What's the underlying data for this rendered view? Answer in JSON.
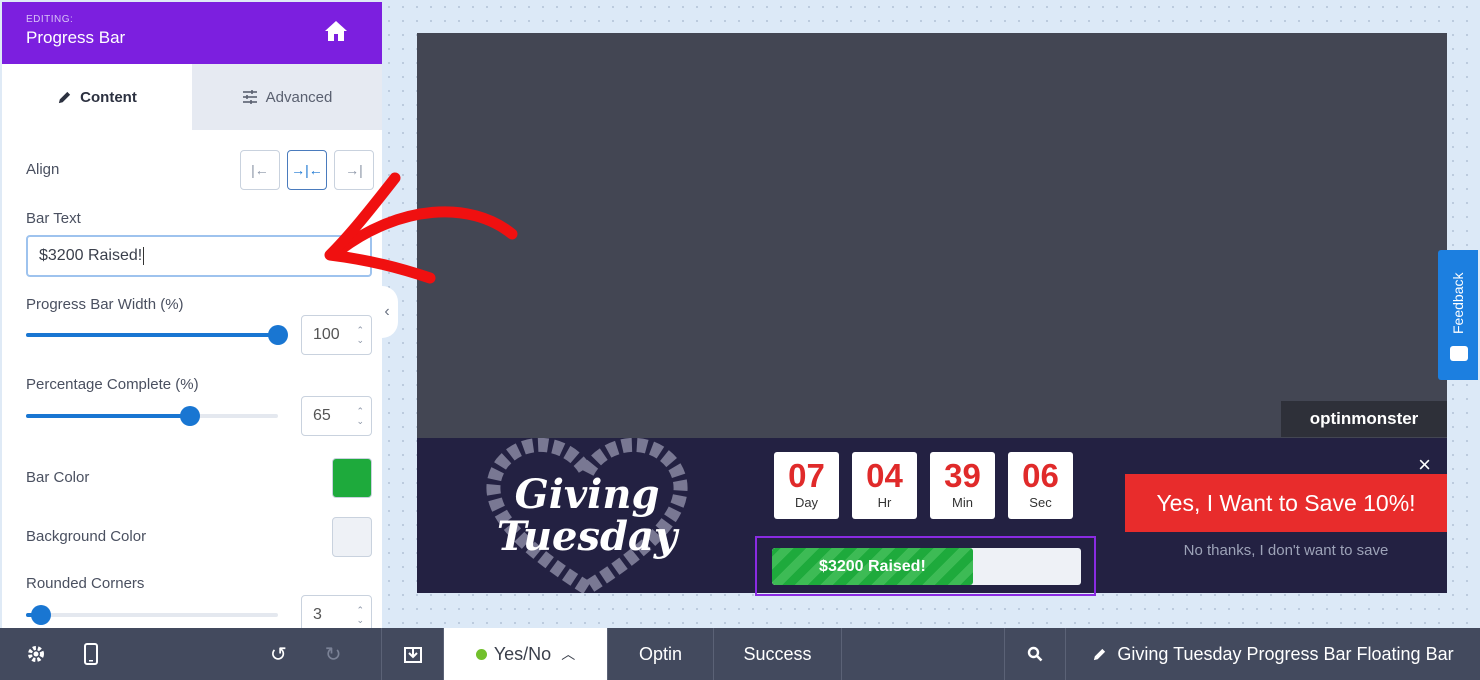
{
  "panel": {
    "eyebrow": "EDITING:",
    "title": "Progress Bar",
    "tabs": [
      {
        "label": "Content",
        "icon": "pencil-icon",
        "active": true
      },
      {
        "label": "Advanced",
        "icon": "sliders-icon",
        "active": false
      }
    ],
    "align": {
      "label": "Align",
      "options": [
        "left",
        "center",
        "right"
      ],
      "selected": "center"
    },
    "bar_text": {
      "label": "Bar Text",
      "value": "$3200 Raised!"
    },
    "bar_width": {
      "label": "Progress Bar Width (%)",
      "value": "100",
      "fraction": 1.0
    },
    "percent_complete": {
      "label": "Percentage Complete (%)",
      "value": "65",
      "fraction": 0.65
    },
    "bar_color": {
      "label": "Bar Color",
      "color": "#1eaa3c"
    },
    "bg_color": {
      "label": "Background Color",
      "color": "#eef1f6"
    },
    "rounded": {
      "label": "Rounded Corners",
      "value": "3",
      "fraction": 0.06
    }
  },
  "preview": {
    "brand": "optinmonster",
    "art_line1": "Giving",
    "art_line2": "Tuesday",
    "countdown": [
      {
        "num": "07",
        "unit": "Day"
      },
      {
        "num": "04",
        "unit": "Hr"
      },
      {
        "num": "39",
        "unit": "Min"
      },
      {
        "num": "06",
        "unit": "Sec"
      }
    ],
    "bar_text": "$3200 Raised!",
    "progress": 0.65,
    "close": "×",
    "cta": "Yes, I Want to Save 10%!",
    "decline": "No thanks, I don't want to save"
  },
  "feedback": {
    "label": "Feedback"
  },
  "bottom": {
    "views": [
      {
        "label": "Yes/No",
        "active": true
      },
      {
        "label": "Optin",
        "active": false
      },
      {
        "label": "Success",
        "active": false
      }
    ],
    "campaign_title": "Giving Tuesday Progress Bar Floating Bar"
  },
  "colors": {
    "accent": "#7c1fdf",
    "primary": "#1976d2",
    "cta": "#e82c2c",
    "countdown": "#e02a2a"
  }
}
